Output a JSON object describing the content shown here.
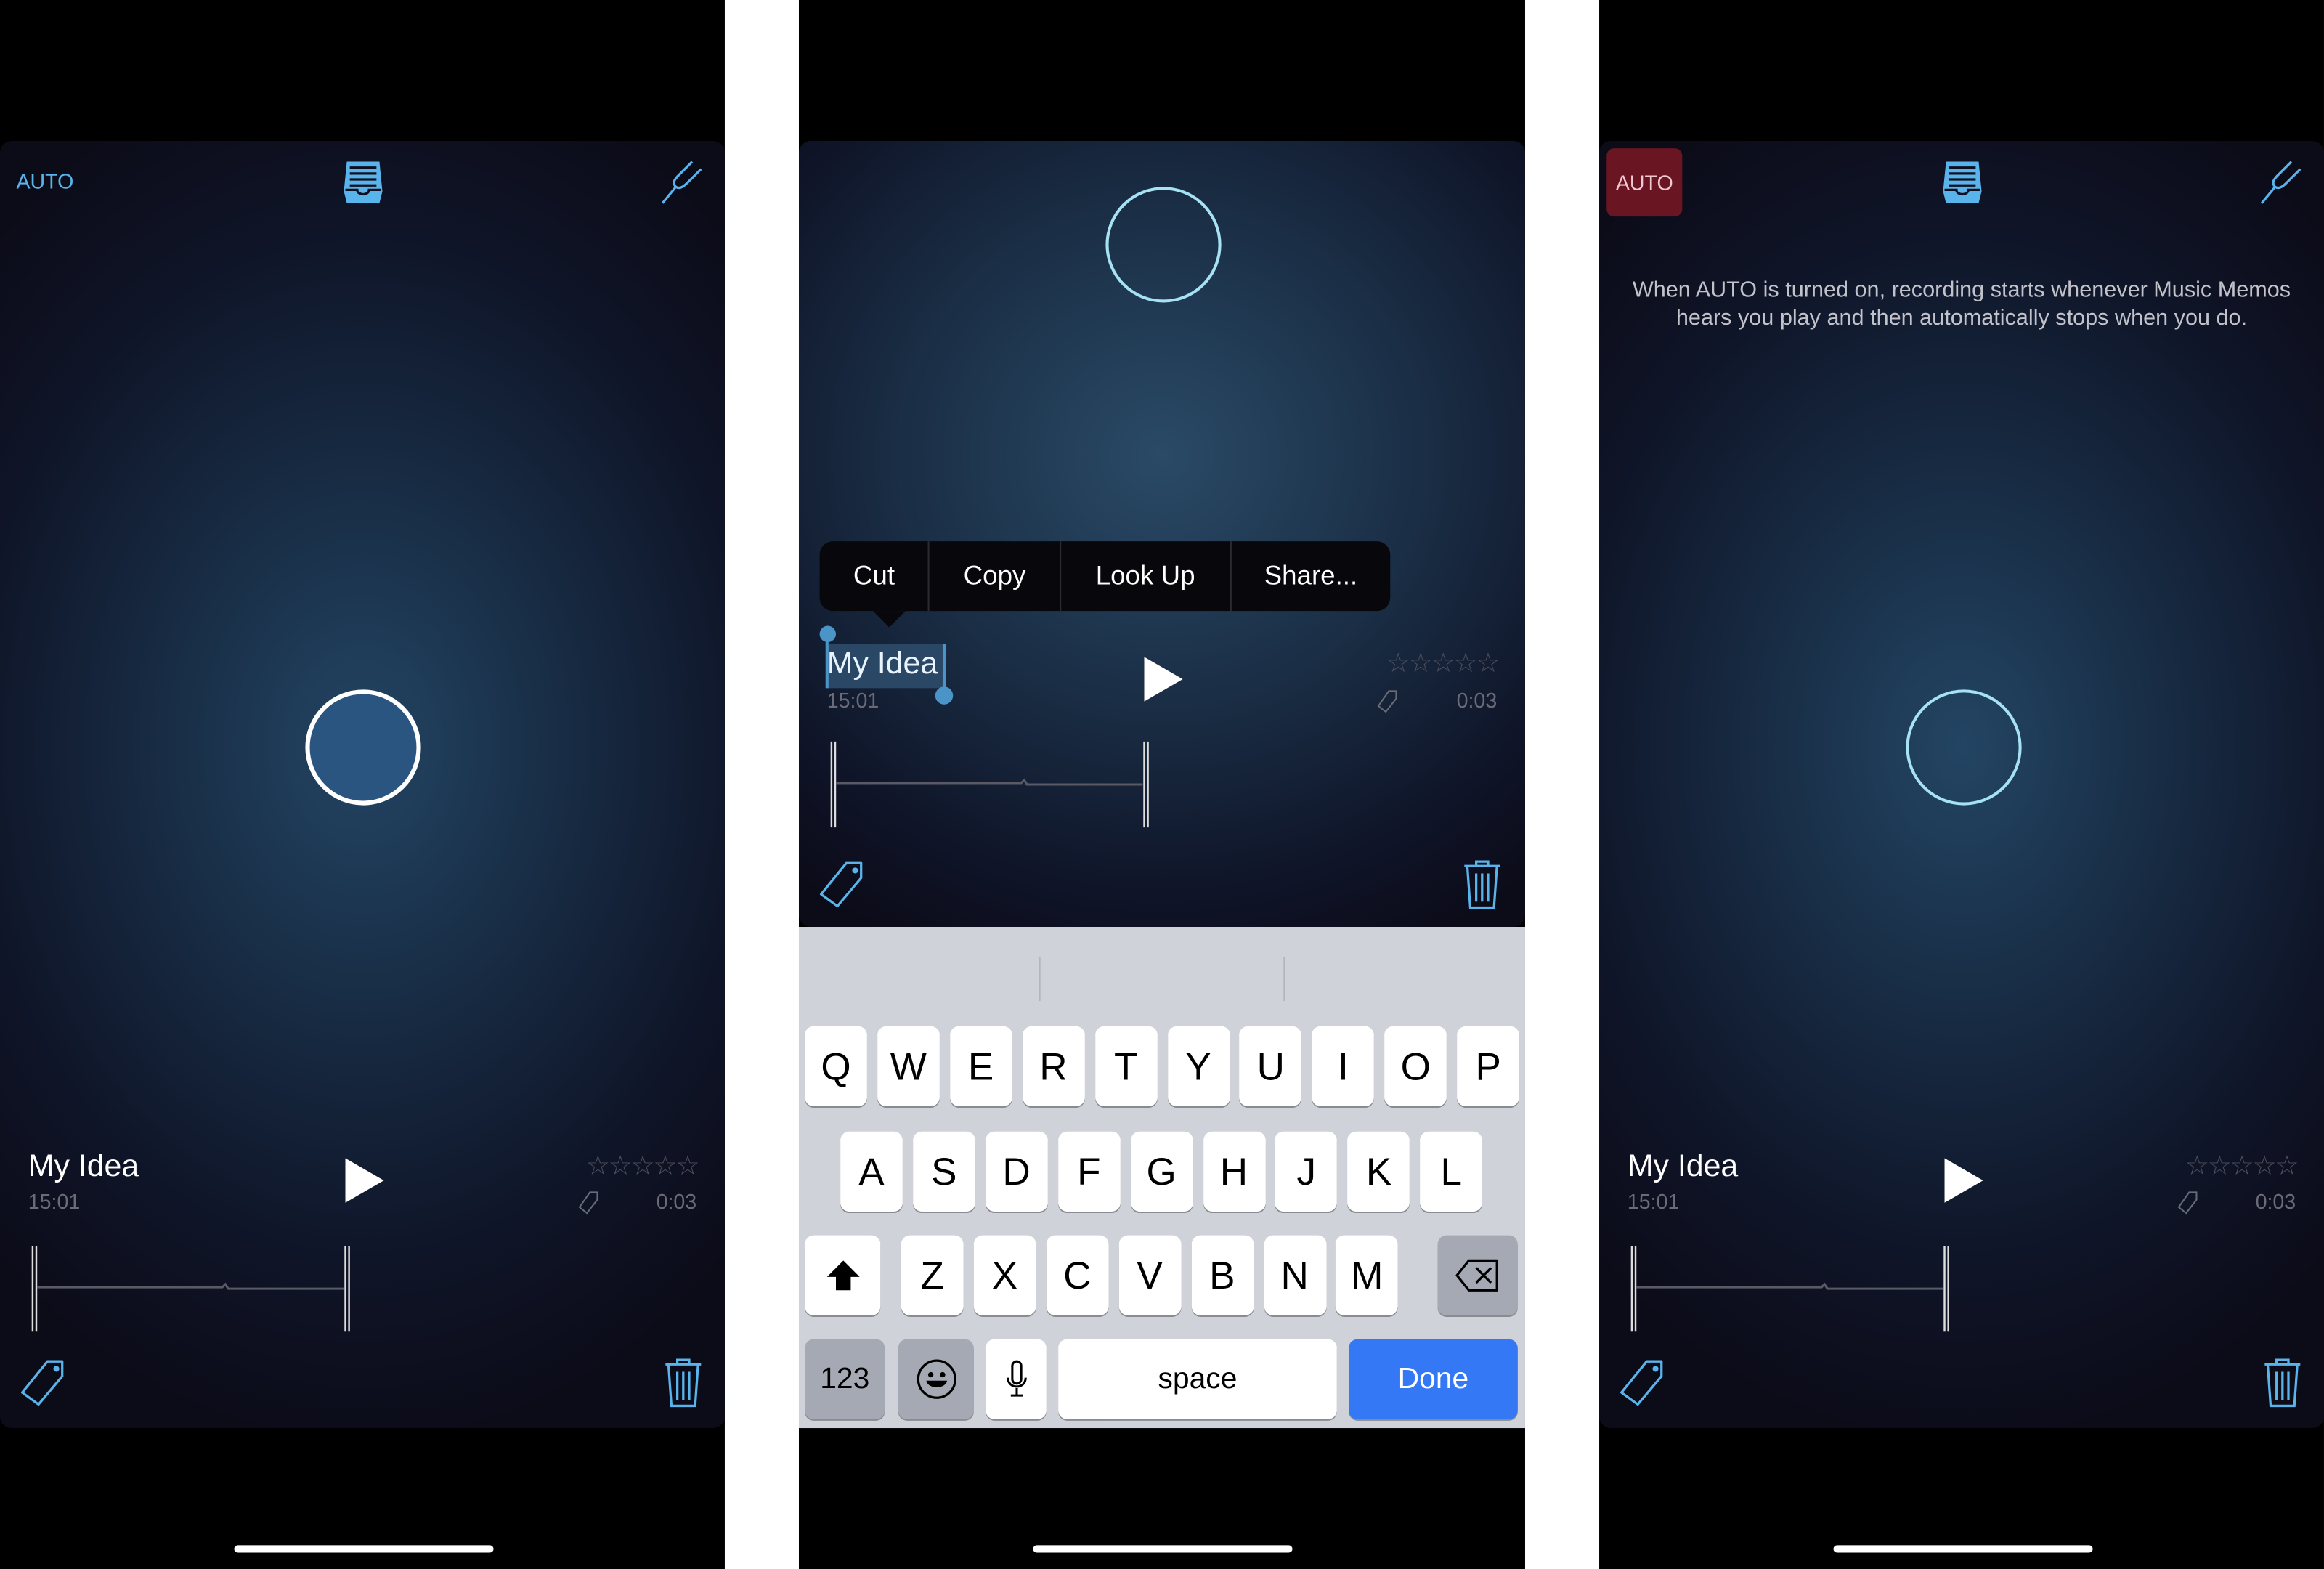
{
  "colors": {
    "accent": "#5ab4ec",
    "auto_on_bg": "#6a1522",
    "done_key": "#3478f6",
    "record_fill": "#2a5580"
  },
  "panels": [
    {
      "auto_label": "AUTO",
      "auto_state": "off",
      "record_button": "filled",
      "memo": {
        "title": "My Idea",
        "time": "15:01",
        "duration": "0:03",
        "rating": 0,
        "stars": "☆☆☆☆☆"
      }
    },
    {
      "record_button": "outline",
      "memo": {
        "title": "My Idea",
        "time": "15:01",
        "duration": "0:03",
        "rating": 0,
        "stars": "☆☆☆☆☆",
        "selected": true
      },
      "edit_menu": [
        "Cut",
        "Copy",
        "Look Up",
        "Share..."
      ],
      "keyboard": {
        "rows": [
          [
            "Q",
            "W",
            "E",
            "R",
            "T",
            "Y",
            "U",
            "I",
            "O",
            "P"
          ],
          [
            "A",
            "S",
            "D",
            "F",
            "G",
            "H",
            "J",
            "K",
            "L"
          ],
          [
            "Z",
            "X",
            "C",
            "V",
            "B",
            "N",
            "M"
          ]
        ],
        "numbers": "123",
        "space": "space",
        "done": "Done"
      }
    },
    {
      "auto_label": "AUTO",
      "auto_state": "on",
      "record_button": "outline",
      "help_text": "When AUTO is turned on, recording starts whenever Music Memos hears you play and then automatically stops when you do.",
      "memo": {
        "title": "My Idea",
        "time": "15:01",
        "duration": "0:03",
        "rating": 0,
        "stars": "☆☆☆☆☆"
      }
    }
  ]
}
